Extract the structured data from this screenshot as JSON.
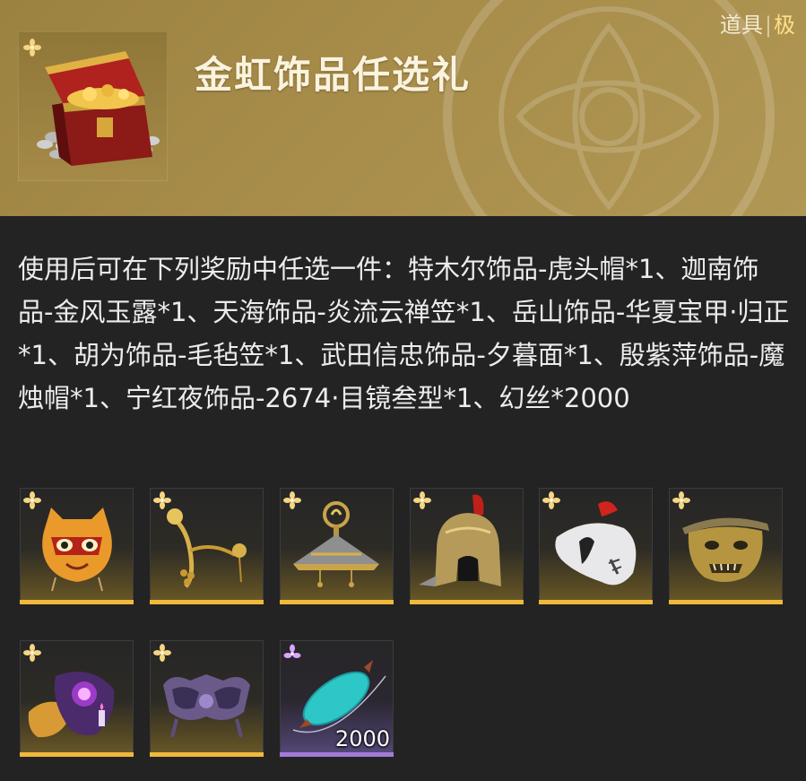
{
  "item": {
    "name": "金虹饰品任选礼",
    "category": "道具",
    "grade": "极",
    "description": "使用后可在下列奖励中任选一件：特木尔饰品-虎头帽*1、迦南饰品-金风玉露*1、天海饰品-炎流云禅笠*1、岳山饰品-华夏宝甲·归正*1、胡为饰品-毛毡笠*1、武田信忠饰品-夕暮面*1、殷紫萍饰品-魔烛帽*1、宁红夜饰品-2674·目镜叁型*1、幻丝*2000"
  },
  "rewards": [
    {
      "icon": "tiger-head-hat-icon",
      "rarity": "gold"
    },
    {
      "icon": "golden-hairpin-icon",
      "rarity": "gold"
    },
    {
      "icon": "flame-cloud-hat-icon",
      "rarity": "gold"
    },
    {
      "icon": "armored-helmet-icon",
      "rarity": "gold"
    },
    {
      "icon": "felt-hat-icon",
      "rarity": "gold"
    },
    {
      "icon": "oni-mask-icon",
      "rarity": "gold"
    },
    {
      "icon": "candle-hat-icon",
      "rarity": "gold"
    },
    {
      "icon": "goggles-icon",
      "rarity": "gold"
    },
    {
      "icon": "silk-spool-icon",
      "rarity": "purple",
      "count": "2000"
    }
  ],
  "colors": {
    "header_gold": "#a78c4a",
    "gold_rarity": "#f0b93a",
    "purple_rarity": "#a47ad9",
    "grade_text": "#ffe08a",
    "panel_bg": "#232323"
  }
}
